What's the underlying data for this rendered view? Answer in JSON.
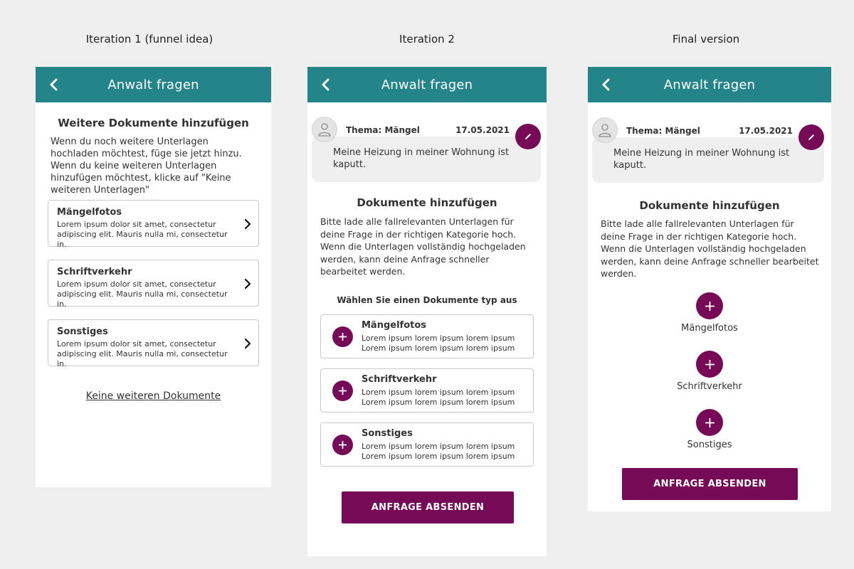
{
  "labels": {
    "col1": "Iteration 1 (funnel idea)",
    "col2": "Iteration 2",
    "col3": "Final version"
  },
  "appbar_title": "Anwalt fragen",
  "screen1": {
    "heading": "Weitere Dokumente hinzufügen",
    "body": "Wenn du noch weitere Unterlagen hochladen möchtest, füge sie jetzt hinzu. Wenn du keine weiteren Unterlagen hinzufügen möchtest, klicke auf \"Keine weiteren Unterlagen\"",
    "cards": [
      {
        "title": "Mängelfotos",
        "desc": "Lorem ipsum dolor sit amet, consectetur adipiscing elit. Mauris nulla mi, consectetur in."
      },
      {
        "title": "Schriftverkehr",
        "desc": "Lorem ipsum dolor sit amet, consectetur adipiscing elit. Mauris nulla mi, consectetur in."
      },
      {
        "title": "Sonstiges",
        "desc": "Lorem ipsum dolor sit amet, consectetur adipiscing elit. Mauris nulla mi, consectetur in."
      }
    ],
    "link": "Keine weiteren Dokumente"
  },
  "thread": {
    "subject": "Thema: Mängel",
    "date": "17.05.2021",
    "message": "Meine Heizung in meiner Wohnung ist kaputt."
  },
  "screen2": {
    "title": "Dokumente hinzufügen",
    "body": "Bitte lade alle fallrelevanten Unterlagen für deine Frage in der richtigen Kategorie hoch. Wenn die Unterlagen vollständig hochgeladen werden, kann deine Anfrage schneller bearbeitet werden.",
    "choose": "Wählen Sie einen Dokumente typ aus",
    "cards": [
      {
        "title": "Mängelfotos",
        "desc": "Lorem ipsum lorem ipsum lorem ipsum Lorem ipsum lorem ipsum lorem ipsum"
      },
      {
        "title": "Schriftverkehr",
        "desc": "Lorem ipsum lorem ipsum lorem ipsum Lorem ipsum lorem ipsum lorem ipsum"
      },
      {
        "title": "Sonstiges",
        "desc": "Lorem ipsum lorem ipsum lorem ipsum Lorem ipsum lorem ipsum lorem ipsum"
      }
    ],
    "submit": "ANFRAGE ABSENDEN"
  },
  "screen3": {
    "title": "Dokumente hinzufügen",
    "body": "Bitte lade alle fallrelevanten Unterlagen für deine Frage in der richtigen Kategorie hoch. Wenn die Unterlagen vollständig hochgeladen werden, kann deine Anfrage schneller bearbeitet werden.",
    "items": [
      "Mängelfotos",
      "Schriftverkehr",
      "Sonstiges"
    ],
    "submit": "ANFRAGE ABSENDEN"
  },
  "colors": {
    "appbar": "#23848a",
    "accent": "#760a57",
    "background": "#efefef"
  },
  "icons": {
    "back": "chevron-left-icon",
    "chevron": "chevron-right-icon",
    "plus": "plus-icon",
    "edit": "pencil-icon",
    "avatar": "user-icon"
  }
}
